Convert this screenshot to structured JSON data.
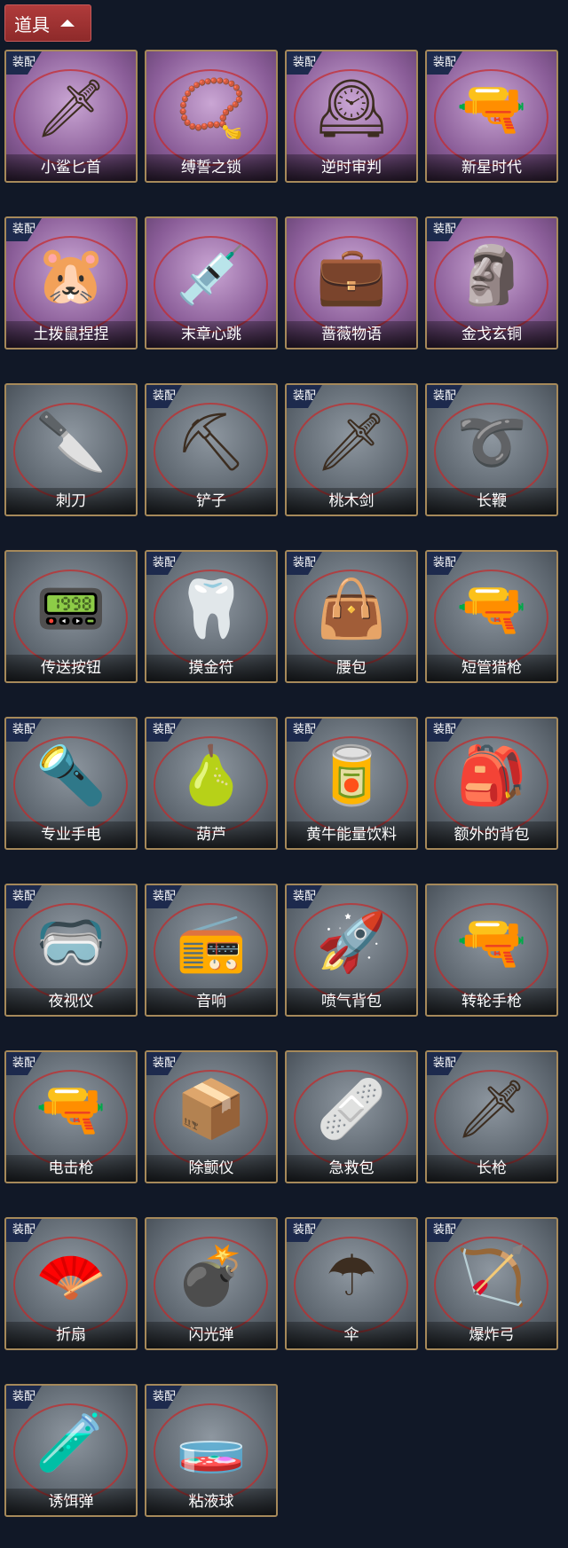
{
  "header": {
    "label": "道具"
  },
  "items": [
    {
      "name": "小鲨匕首",
      "equipped": true,
      "theme": "purple",
      "icon": "🗡"
    },
    {
      "name": "缚誓之锁",
      "equipped": false,
      "theme": "purple",
      "icon": "📿"
    },
    {
      "name": "逆时审判",
      "equipped": true,
      "theme": "purple",
      "icon": "🕰"
    },
    {
      "name": "新星时代",
      "equipped": true,
      "theme": "purple",
      "icon": "🔫"
    },
    {
      "name": "土拨鼠捏捏",
      "equipped": true,
      "theme": "purple",
      "icon": "🐹"
    },
    {
      "name": "末章心跳",
      "equipped": false,
      "theme": "purple",
      "icon": "💉"
    },
    {
      "name": "蔷薇物语",
      "equipped": false,
      "theme": "purple",
      "icon": "💼"
    },
    {
      "name": "金戈玄铜",
      "equipped": true,
      "theme": "purple",
      "icon": "🗿"
    },
    {
      "name": "刺刀",
      "equipped": false,
      "theme": "grey",
      "icon": "🔪"
    },
    {
      "name": "铲子",
      "equipped": true,
      "theme": "grey",
      "icon": "⛏"
    },
    {
      "name": "桃木剑",
      "equipped": true,
      "theme": "grey",
      "icon": "🗡"
    },
    {
      "name": "长鞭",
      "equipped": true,
      "theme": "grey",
      "icon": "➰"
    },
    {
      "name": "传送按钮",
      "equipped": false,
      "theme": "grey",
      "icon": "📟"
    },
    {
      "name": "摸金符",
      "equipped": true,
      "theme": "grey",
      "icon": "🦷"
    },
    {
      "name": "腰包",
      "equipped": true,
      "theme": "grey",
      "icon": "👜"
    },
    {
      "name": "短管猎枪",
      "equipped": true,
      "theme": "grey",
      "icon": "🔫"
    },
    {
      "name": "专业手电",
      "equipped": true,
      "theme": "grey",
      "icon": "🔦"
    },
    {
      "name": "葫芦",
      "equipped": true,
      "theme": "grey",
      "icon": "🍐"
    },
    {
      "name": "黄牛能量饮料",
      "equipped": true,
      "theme": "grey",
      "icon": "🥫"
    },
    {
      "name": "额外的背包",
      "equipped": true,
      "theme": "grey",
      "icon": "🎒"
    },
    {
      "name": "夜视仪",
      "equipped": true,
      "theme": "grey",
      "icon": "🥽"
    },
    {
      "name": "音响",
      "equipped": true,
      "theme": "grey",
      "icon": "📻"
    },
    {
      "name": "喷气背包",
      "equipped": true,
      "theme": "grey",
      "icon": "🚀"
    },
    {
      "name": "转轮手枪",
      "equipped": false,
      "theme": "grey",
      "icon": "🔫"
    },
    {
      "name": "电击枪",
      "equipped": true,
      "theme": "grey",
      "icon": "🔫"
    },
    {
      "name": "除颤仪",
      "equipped": true,
      "theme": "grey",
      "icon": "📦"
    },
    {
      "name": "急救包",
      "equipped": false,
      "theme": "grey",
      "icon": "🩹"
    },
    {
      "name": "长枪",
      "equipped": true,
      "theme": "grey",
      "icon": "🗡"
    },
    {
      "name": "折扇",
      "equipped": true,
      "theme": "grey",
      "icon": "🪭"
    },
    {
      "name": "闪光弹",
      "equipped": false,
      "theme": "grey",
      "icon": "💣"
    },
    {
      "name": "伞",
      "equipped": true,
      "theme": "grey",
      "icon": "☂"
    },
    {
      "name": "爆炸弓",
      "equipped": true,
      "theme": "grey",
      "icon": "🏹"
    },
    {
      "name": "诱饵弹",
      "equipped": true,
      "theme": "grey",
      "icon": "🧪"
    },
    {
      "name": "粘液球",
      "equipped": true,
      "theme": "grey",
      "icon": "🧫"
    }
  ],
  "badge_text": "装配"
}
